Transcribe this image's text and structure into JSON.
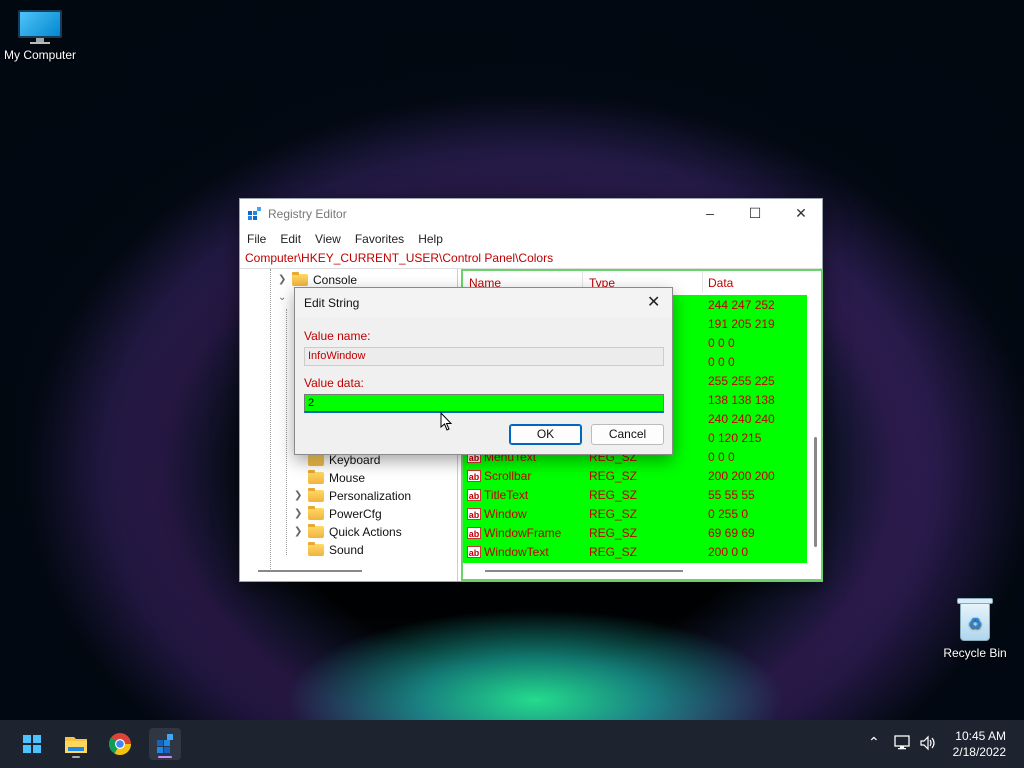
{
  "desktop": {
    "icons": [
      {
        "label": "My Computer",
        "icon": "monitor-icon"
      },
      {
        "label": "Recycle Bin",
        "icon": "recycle-bin-icon"
      }
    ]
  },
  "regedit": {
    "title": "Registry Editor",
    "menu": [
      "File",
      "Edit",
      "View",
      "Favorites",
      "Help"
    ],
    "address": "Computer\\HKEY_CURRENT_USER\\Control Panel\\Colors",
    "tree": {
      "console": "Console",
      "keyboard": "Keyboard",
      "mouse": "Mouse",
      "personalization": "Personalization",
      "powercfg": "PowerCfg",
      "quick_actions": "Quick Actions",
      "sound": "Sound"
    },
    "columns": {
      "name": "Name",
      "type": "Type",
      "data": "Data"
    },
    "values": [
      {
        "name": "",
        "type": "",
        "data": "244 247 252"
      },
      {
        "name": "",
        "type": "",
        "data": "191 205 219"
      },
      {
        "name": "",
        "type": "",
        "data": "0 0 0"
      },
      {
        "name": "",
        "type": "",
        "data": "0 0 0"
      },
      {
        "name": "",
        "type": "",
        "data": "255 255 225"
      },
      {
        "name": "",
        "type": "",
        "data": "138 138 138"
      },
      {
        "name": "",
        "type": "",
        "data": "240 240 240"
      },
      {
        "name": "",
        "type": "",
        "data": "0 120 215"
      },
      {
        "name": "MenuText",
        "type": "REG_SZ",
        "data": "0 0 0"
      },
      {
        "name": "Scrollbar",
        "type": "REG_SZ",
        "data": "200 200 200"
      },
      {
        "name": "TitleText",
        "type": "REG_SZ",
        "data": "55 55 55"
      },
      {
        "name": "Window",
        "type": "REG_SZ",
        "data": "0 255 0"
      },
      {
        "name": "WindowFrame",
        "type": "REG_SZ",
        "data": "69 69 69"
      },
      {
        "name": "WindowText",
        "type": "REG_SZ",
        "data": "200 0 0"
      }
    ]
  },
  "dialog": {
    "title": "Edit String",
    "value_name_label": "Value name:",
    "value_name": "InfoWindow",
    "value_data_label": "Value data:",
    "value_data": "2",
    "ok": "OK",
    "cancel": "Cancel"
  },
  "taskbar": {
    "apps": [
      "start-icon",
      "file-explorer-icon",
      "chrome-icon",
      "registry-editor-icon"
    ],
    "time": "10:45 AM",
    "date": "2/18/2022"
  },
  "colors": {
    "accent": "#0067c0",
    "highlight_green": "#00ff00",
    "text_red": "#c00000"
  }
}
